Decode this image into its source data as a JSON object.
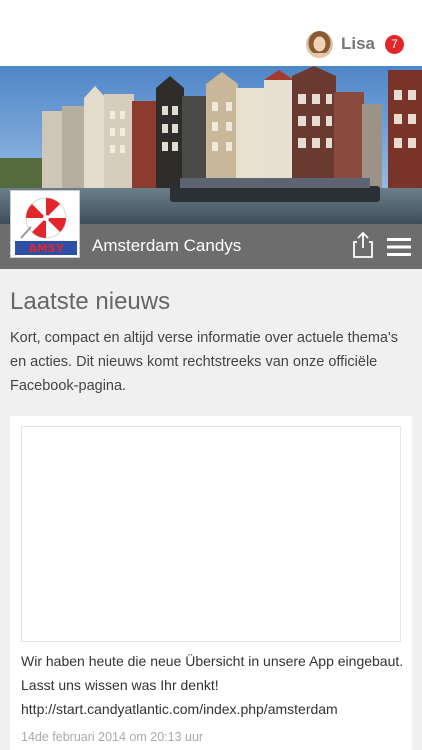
{
  "header": {
    "username": "Lisa",
    "notification_count": "7",
    "icons": [
      "avatar",
      "notification-badge"
    ]
  },
  "app": {
    "title": "Amsterdam Candys",
    "logo_text": "AMSY",
    "icons": [
      "share-icon",
      "hamburger-menu-icon"
    ]
  },
  "news": {
    "title": "Laatste nieuws",
    "intro": "Kort, compact en altijd verse informatie over actuele thema's en acties. Dit nieuws komt rechtstreeks van onze officiële Facebook-pagina."
  },
  "posts": [
    {
      "line1": "Wir haben heute die neue Übersicht in unsere App eingebaut.",
      "line2": "Lasst uns wissen was Ihr denkt!",
      "link": "http://start.candyatlantic.com/index.php/amsterdam",
      "date": "14de februari 2014 om 20:13 uur"
    }
  ],
  "colors": {
    "titlebar": "#6d6d6d",
    "badge": "#e2262b",
    "background": "#f0f0f0"
  }
}
